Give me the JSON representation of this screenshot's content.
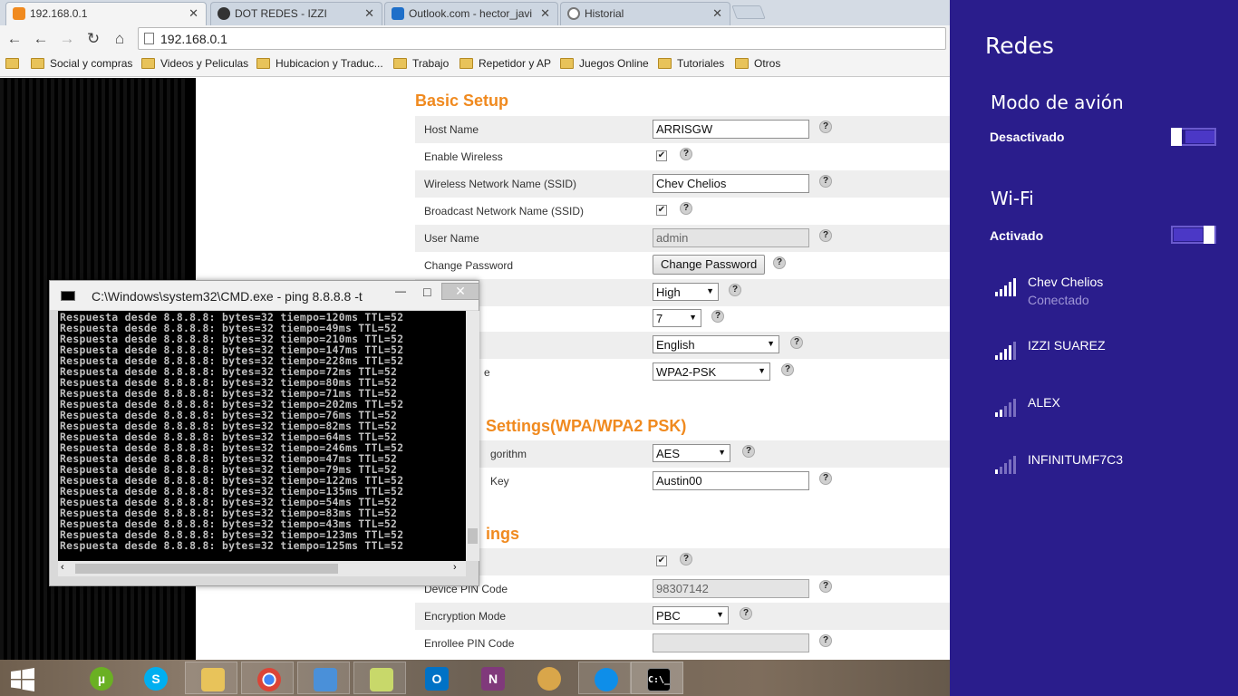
{
  "browser": {
    "tabs": [
      {
        "title": "192.168.0.1",
        "icon": "router-icon",
        "color": "#f08a1f"
      },
      {
        "title": "DOT REDES - IZZI",
        "icon": "dot-redes-icon",
        "color": "#333333"
      },
      {
        "title": "Outlook.com - hector_javi",
        "icon": "outlook-icon",
        "color": "#1e6fc9"
      },
      {
        "title": "Historial",
        "icon": "history-icon",
        "color": "#777777"
      }
    ],
    "url": "192.168.0.1",
    "bookmarks": [
      "Social y compras",
      "Videos y Peliculas",
      "Hubicacion y Traduc...",
      "Trabajo",
      "Repetidor y AP",
      "Juegos Online",
      "Tutoriales",
      "Otros"
    ]
  },
  "router": {
    "basic_setup_title": "Basic Setup",
    "host_name_label": "Host Name",
    "host_name_value": "ARRISGW",
    "enable_wireless_label": "Enable Wireless",
    "ssid_label": "Wireless Network Name (SSID)",
    "ssid_value": "Chev Chelios",
    "broadcast_label": "Broadcast Network Name (SSID)",
    "user_name_label": "User Name",
    "user_name_value": "admin",
    "change_password_label": "Change Password",
    "change_password_button": "Change Password",
    "power_level_label": "vel",
    "power_level_value": "High",
    "channel_value": "7",
    "language_value": "English",
    "security_mode_label": "e",
    "security_mode_value": "WPA2-PSK",
    "wpa_title": "Settings(WPA/WPA2 PSK)",
    "algorithm_label": "gorithm",
    "algorithm_value": "AES",
    "key_label": "Key",
    "key_value": "Austin00",
    "wps_title": "ings",
    "device_pin_label": "Device PIN Code",
    "device_pin_value": "98307142",
    "encryption_mode_label": "Encryption Mode",
    "encryption_mode_value": "PBC",
    "enrollee_pin_label": "Enrollee PIN Code",
    "help": "?",
    "check": "✔"
  },
  "cmd": {
    "title": "C:\\Windows\\system32\\CMD.exe - ping  8.8.8.8 -t",
    "minimize": "—",
    "maximize": "□",
    "close": "✕",
    "lines": [
      "Respuesta desde 8.8.8.8: bytes=32 tiempo=120ms TTL=52",
      "Respuesta desde 8.8.8.8: bytes=32 tiempo=49ms TTL=52",
      "Respuesta desde 8.8.8.8: bytes=32 tiempo=210ms TTL=52",
      "Respuesta desde 8.8.8.8: bytes=32 tiempo=147ms TTL=52",
      "Respuesta desde 8.8.8.8: bytes=32 tiempo=228ms TTL=52",
      "Respuesta desde 8.8.8.8: bytes=32 tiempo=72ms TTL=52",
      "Respuesta desde 8.8.8.8: bytes=32 tiempo=80ms TTL=52",
      "Respuesta desde 8.8.8.8: bytes=32 tiempo=71ms TTL=52",
      "Respuesta desde 8.8.8.8: bytes=32 tiempo=202ms TTL=52",
      "Respuesta desde 8.8.8.8: bytes=32 tiempo=76ms TTL=52",
      "Respuesta desde 8.8.8.8: bytes=32 tiempo=82ms TTL=52",
      "Respuesta desde 8.8.8.8: bytes=32 tiempo=64ms TTL=52",
      "Respuesta desde 8.8.8.8: bytes=32 tiempo=246ms TTL=52",
      "Respuesta desde 8.8.8.8: bytes=32 tiempo=47ms TTL=52",
      "Respuesta desde 8.8.8.8: bytes=32 tiempo=79ms TTL=52",
      "Respuesta desde 8.8.8.8: bytes=32 tiempo=122ms TTL=52",
      "Respuesta desde 8.8.8.8: bytes=32 tiempo=135ms TTL=52",
      "Respuesta desde 8.8.8.8: bytes=32 tiempo=54ms TTL=52",
      "Respuesta desde 8.8.8.8: bytes=32 tiempo=83ms TTL=52",
      "Respuesta desde 8.8.8.8: bytes=32 tiempo=43ms TTL=52",
      "Respuesta desde 8.8.8.8: bytes=32 tiempo=123ms TTL=52",
      "Respuesta desde 8.8.8.8: bytes=32 tiempo=125ms TTL=52"
    ]
  },
  "networks_panel": {
    "title": "Redes",
    "airplane_label": "Modo de avión",
    "airplane_state": "Desactivado",
    "airplane_on": false,
    "wifi_label": "Wi-Fi",
    "wifi_state": "Activado",
    "wifi_on": true,
    "accent": "#2a1d8c",
    "networks": [
      {
        "name": "Chev Chelios",
        "status": "Conectado"
      },
      {
        "name": "IZZI SUAREZ",
        "status": ""
      },
      {
        "name": "ALEX",
        "status": ""
      },
      {
        "name": "INFINITUMF7C3",
        "status": ""
      }
    ]
  },
  "taskbar": {
    "items": [
      {
        "icon": "windows-start-icon",
        "label": "",
        "color": "#ffffff"
      },
      {
        "icon": "utorrent-icon",
        "label": "µ",
        "color": "#6ab023"
      },
      {
        "icon": "skype-icon",
        "label": "S",
        "color": "#00aff0"
      },
      {
        "icon": "file-explorer-icon",
        "label": "",
        "color": "#e8c35a"
      },
      {
        "icon": "chrome-icon",
        "label": "",
        "color": "#db4437"
      },
      {
        "icon": "network-tool-icon",
        "label": "",
        "color": "#4a90d9"
      },
      {
        "icon": "sticky-notes-icon",
        "label": "",
        "color": "#c8d86a"
      },
      {
        "icon": "outlook-icon",
        "label": "O",
        "color": "#0072c6"
      },
      {
        "icon": "onenote-icon",
        "label": "N",
        "color": "#80397b"
      },
      {
        "icon": "paint-icon",
        "label": "",
        "color": "#d9a64a"
      },
      {
        "icon": "teamviewer-icon",
        "label": "",
        "color": "#0e8ee9"
      },
      {
        "icon": "cmd-icon",
        "label": "C:\\_",
        "color": "#000000"
      }
    ]
  }
}
